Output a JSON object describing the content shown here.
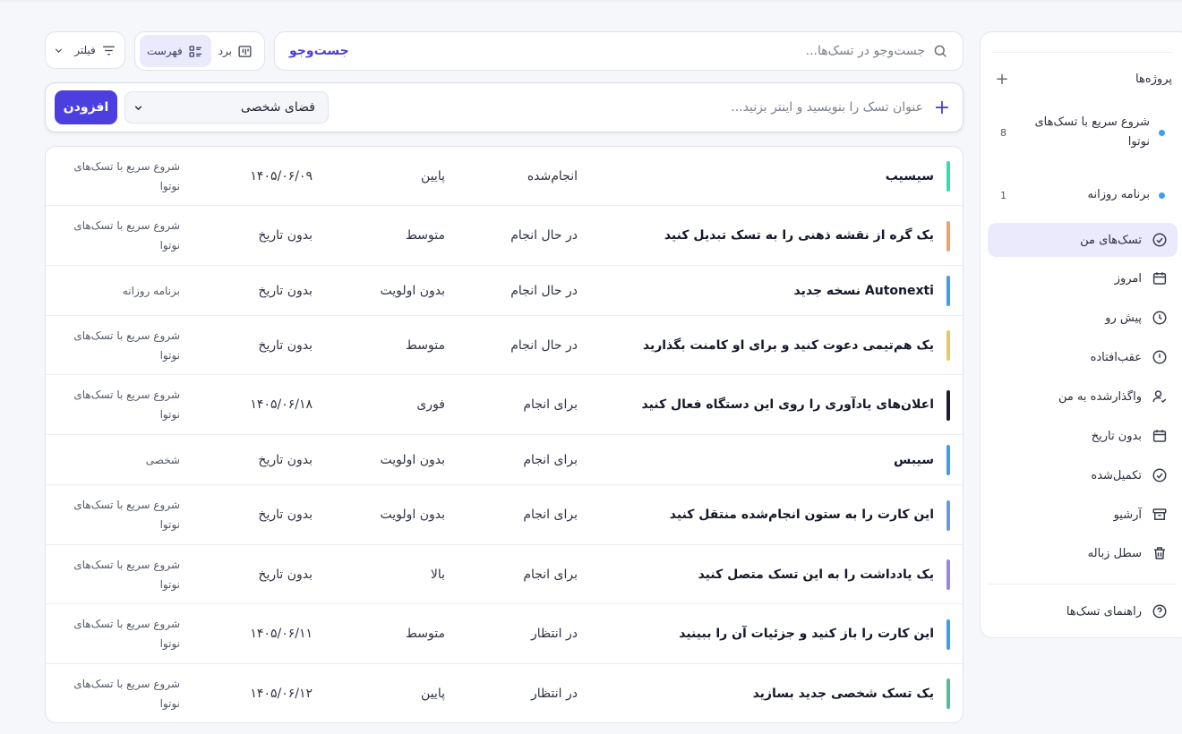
{
  "sidebar": {
    "projects_title": "پروژه‌ها",
    "projects": [
      {
        "name": "شروع سریع با تسک‌های نوتوا",
        "count": "8",
        "color": "#3aa0f0"
      },
      {
        "name": "برنامه روزانه",
        "count": "1",
        "color": "#3aa0f0"
      }
    ],
    "items": [
      {
        "label": "تسک‌های من",
        "icon": "check-circle-icon",
        "active": true
      },
      {
        "label": "امروز",
        "icon": "calendar-icon"
      },
      {
        "label": "پیش رو",
        "icon": "clock-icon"
      },
      {
        "label": "عقب‌افتاده",
        "icon": "alert-circle-icon"
      },
      {
        "label": "واگذارشده به من",
        "icon": "user-check-icon"
      },
      {
        "label": "بدون تاریخ",
        "icon": "calendar-icon"
      },
      {
        "label": "تکمیل‌شده",
        "icon": "check-circle-icon"
      },
      {
        "label": "آرشیو",
        "icon": "archive-icon"
      },
      {
        "label": "سطل زباله",
        "icon": "trash-icon"
      }
    ],
    "help": {
      "label": "راهنمای تسک‌ها",
      "icon": "help-circle-icon"
    }
  },
  "search": {
    "placeholder": "جست‌وجو در تسک‌ها...",
    "button_label": "جست‌وجو"
  },
  "view_toggle": {
    "board_label": "برد",
    "list_label": "فهرست",
    "active": "list"
  },
  "filter": {
    "label": "فیلتر"
  },
  "quick_add": {
    "placeholder": "عنوان تسک را بنویسید و اینتر بزنید...",
    "workspace": "فضای شخصی",
    "add_label": "افزودن",
    "accent": "#4b3fe0"
  },
  "tasks": [
    {
      "title": "سیسیب",
      "status": "انجام‌شده",
      "priority": "پایین",
      "date": "۱۴۰۵/۰۶/۰۹",
      "project": "شروع سریع با تسک‌های نوتوا",
      "color": "#2ee0b0"
    },
    {
      "title": "یک گره از نقشه ذهنی را به تسک تبدیل کنید",
      "status": "در حال انجام",
      "priority": "متوسط",
      "date": "بدون تاریخ",
      "project": "شروع سریع با تسک‌های نوتوا",
      "color": "#f0a064"
    },
    {
      "title": "نسخه جدید Autonexti",
      "status": "در حال انجام",
      "priority": "بدون اولویت",
      "date": "بدون تاریخ",
      "project": "برنامه روزانه",
      "color": "#3aa0f0"
    },
    {
      "title": "یک هم‌تیمی دعوت کنید و برای او کامنت بگذارید",
      "status": "در حال انجام",
      "priority": "متوسط",
      "date": "بدون تاریخ",
      "project": "شروع سریع با تسک‌های نوتوا",
      "color": "#e8c860"
    },
    {
      "title": "اعلان‌های یادآوری را روی این دستگاه فعال کنید",
      "status": "برای انجام",
      "priority": "فوری",
      "date": "۱۴۰۵/۰۶/۱۸",
      "project": "شروع سریع با تسک‌های نوتوا",
      "color": "#1c1c30"
    },
    {
      "title": "سیبس",
      "status": "برای انجام",
      "priority": "بدون اولویت",
      "date": "بدون تاریخ",
      "project": "شخصی",
      "color": "#3aa0f0"
    },
    {
      "title": "این کارت را به ستون انجام‌شده منتقل کنید",
      "status": "برای انجام",
      "priority": "بدون اولویت",
      "date": "بدون تاریخ",
      "project": "شروع سریع با تسک‌های نوتوا",
      "color": "#6a98e8"
    },
    {
      "title": "یک یادداشت را به این تسک متصل کنید",
      "status": "برای انجام",
      "priority": "بالا",
      "date": "بدون تاریخ",
      "project": "شروع سریع با تسک‌های نوتوا",
      "color": "#9a84e8"
    },
    {
      "title": "این کارت را باز کنید و جزئیات آن را ببینید",
      "status": "در انتظار",
      "priority": "متوسط",
      "date": "۱۴۰۵/۰۶/۱۱",
      "project": "شروع سریع با تسک‌های نوتوا",
      "color": "#3aa0f0"
    },
    {
      "title": "یک تسک شخصی جدید بسازید",
      "status": "در انتظار",
      "priority": "پایین",
      "date": "۱۴۰۵/۰۶/۱۲",
      "project": "شروع سریع با تسک‌های نوتوا",
      "color": "#50c090"
    }
  ]
}
